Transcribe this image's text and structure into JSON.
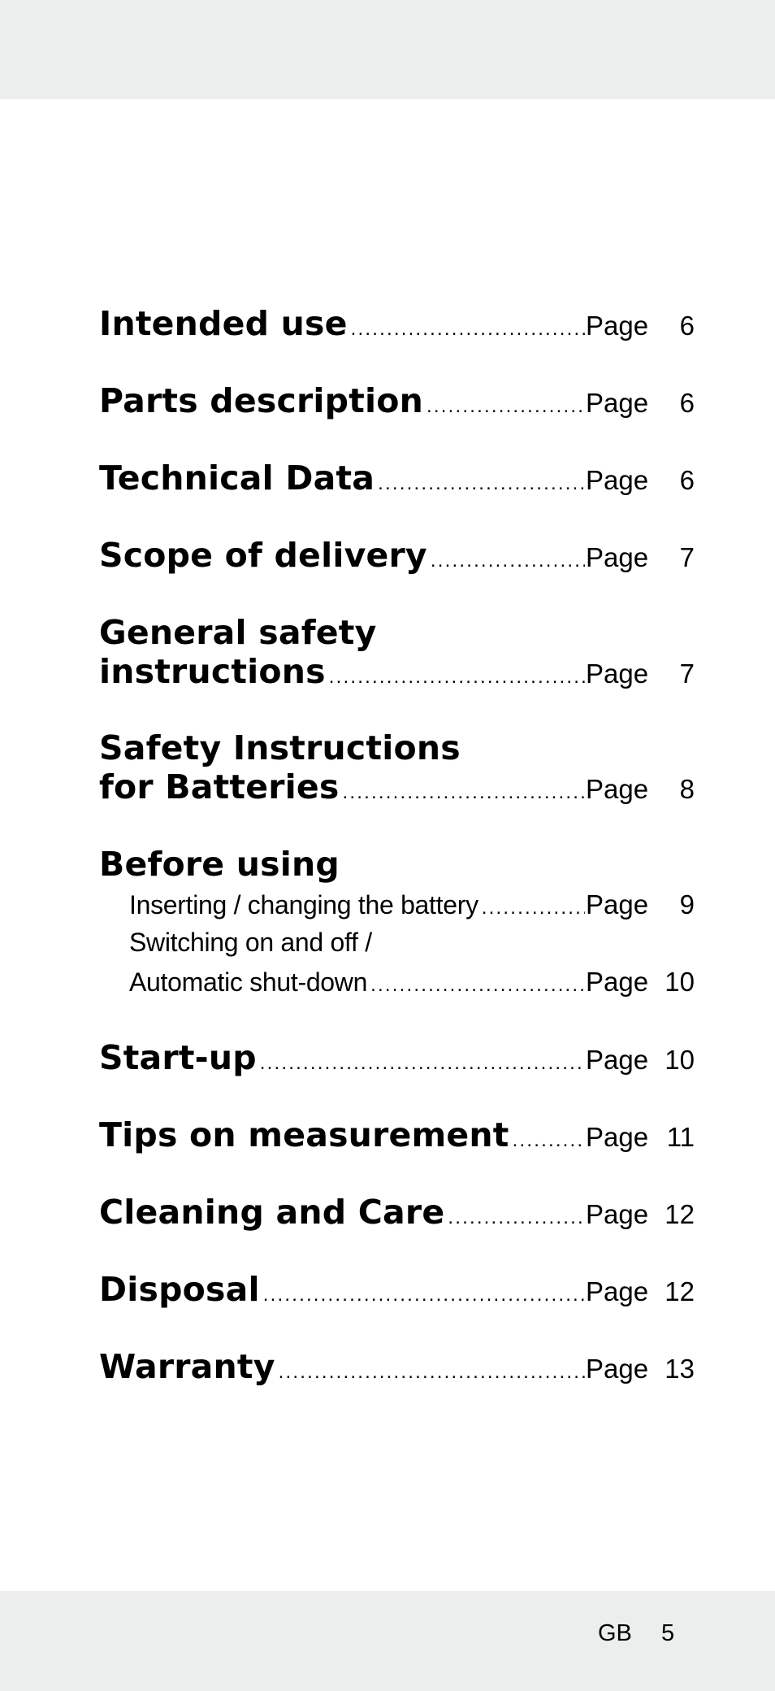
{
  "toc": {
    "page_label": "Page",
    "entries": [
      {
        "title": "Intended use",
        "page": "6"
      },
      {
        "title": "Parts description",
        "page": "6"
      },
      {
        "title": "Technical Data",
        "page": "6"
      },
      {
        "title": "Scope of delivery",
        "page": "7"
      },
      {
        "title_line1": "General safety",
        "title": "instructions",
        "page": "7"
      },
      {
        "title_line1": "Safety Instructions",
        "title": "for Batteries",
        "page": "8"
      },
      {
        "title": "Before using",
        "subitems": [
          {
            "title": "Inserting / changing the battery",
            "page": "9"
          },
          {
            "title_line1": "Switching on and off /",
            "title": "Automatic shut-down",
            "page": "10"
          }
        ]
      },
      {
        "title": "Start-up",
        "page": "10"
      },
      {
        "title": "Tips on measurement",
        "page": "11"
      },
      {
        "title": "Cleaning and Care",
        "page": "12"
      },
      {
        "title": "Disposal",
        "page": "12"
      },
      {
        "title": "Warranty",
        "page": "13"
      }
    ]
  },
  "footer": {
    "language_code": "GB",
    "page_number": "5"
  },
  "colors": {
    "band_background": "#eceeed",
    "page_background": "#ffffff",
    "text": "#000000"
  }
}
